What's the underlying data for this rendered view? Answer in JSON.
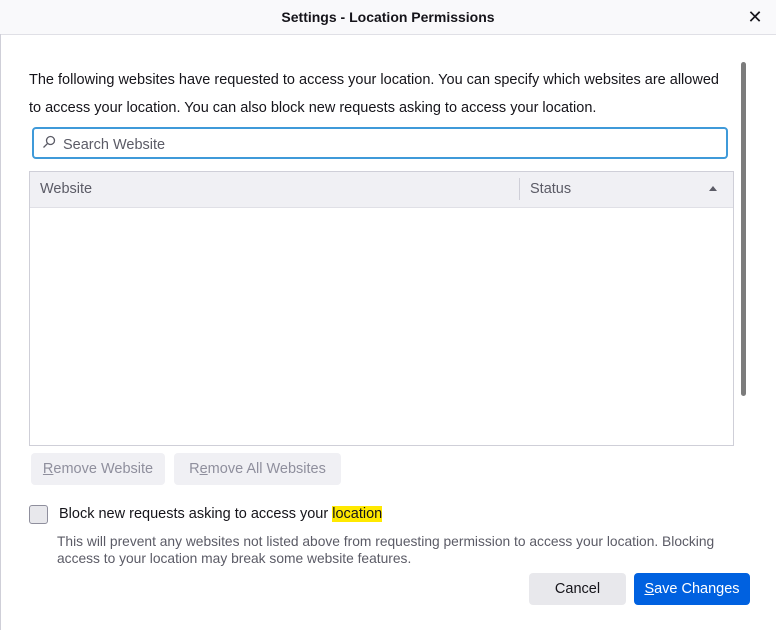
{
  "window": {
    "title": "Settings - Location Permissions",
    "close_glyph": "✕"
  },
  "description": "The following websites have requested to access your location. You can specify which websites are allowed to access your location. You can also block new requests asking to access your location.",
  "search": {
    "placeholder": "Search Website",
    "value": ""
  },
  "table": {
    "columns": [
      "Website",
      "Status"
    ],
    "rows": []
  },
  "buttons": {
    "remove_website": {
      "accesskey": "R",
      "rest": "emove Website"
    },
    "remove_all": {
      "accesskey": "e",
      "prefix": "R",
      "rest": "move All Websites"
    },
    "cancel": "Cancel",
    "save": {
      "accesskey": "S",
      "rest": "ave Changes"
    }
  },
  "block": {
    "label_prefix": "Block new requests asking to access your ",
    "label_highlight": "location",
    "checked": false,
    "description": "This will prevent any websites not listed above from requesting permission to access your location. Blocking access to your location may break some website features."
  },
  "colors": {
    "accent": "#0061e0",
    "focus_ring": "#3f9ad9",
    "highlight": "#ffe900"
  }
}
